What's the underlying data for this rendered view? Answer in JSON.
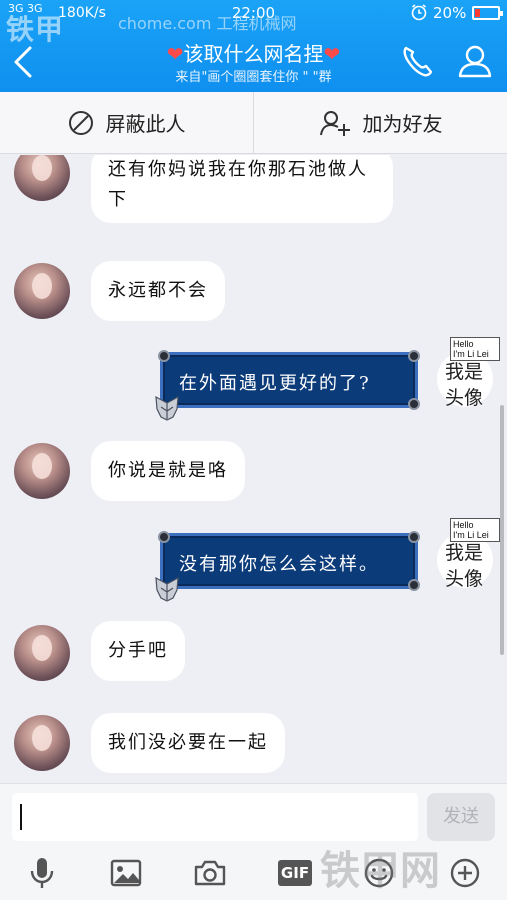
{
  "status_bar": {
    "network": "3G 3G",
    "speed": "180K/s",
    "time": "22:00",
    "battery_percent": "20%",
    "battery_level": 0.2
  },
  "watermark": {
    "brand": "铁甲",
    "site": "工程机械网",
    "url": "chome.com",
    "bottom": "铁甲网"
  },
  "header": {
    "title": "该取什么网名捏",
    "subtitle": "来自\"画个圈圈套住你 \" \"群",
    "accent_color": "#1296f3"
  },
  "actions": {
    "block_label": "屏蔽此人",
    "add_friend_label": "加为好友"
  },
  "messages": [
    {
      "from": "other",
      "text": "还有你妈说我在你那石池做人下"
    },
    {
      "from": "other",
      "text": "永远都不会"
    },
    {
      "from": "me",
      "text": "在外面遇见更好的了?"
    },
    {
      "from": "other",
      "text": "你说是就是咯"
    },
    {
      "from": "me",
      "text": "没有那你怎么会这样。"
    },
    {
      "from": "other",
      "text": "分手吧"
    },
    {
      "from": "other",
      "text": "我们没必要在一起"
    }
  ],
  "my_avatar": {
    "card_line1": "Hello",
    "card_line2": "I'm Li Lei",
    "text": "我是头像"
  },
  "composer": {
    "value": "",
    "send_label": "发送"
  },
  "toolbar": {
    "gif_label": "GIF"
  }
}
